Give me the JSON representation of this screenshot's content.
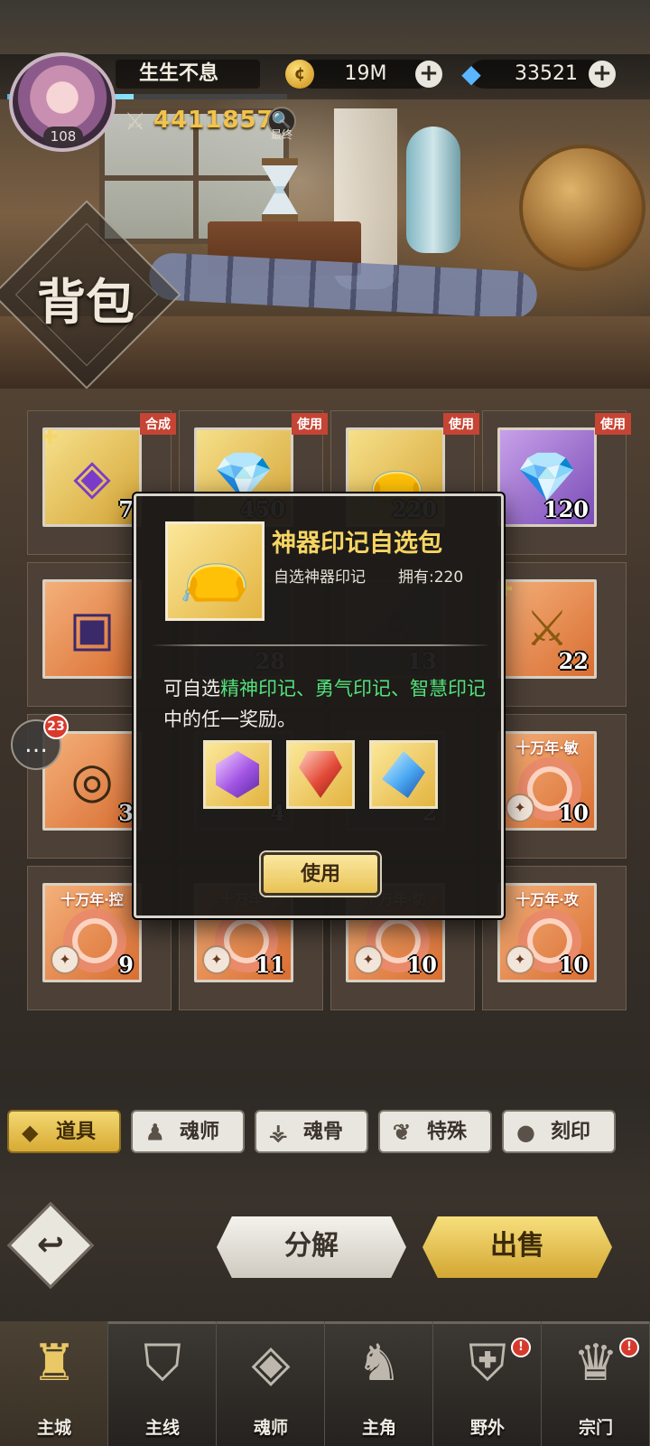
{
  "header": {
    "page_title": "背包",
    "player_name": "生生不息",
    "player_level": "108",
    "xp_progress": 0.45,
    "power": "44118570",
    "rank_label": "最终",
    "gold": "19M",
    "diamonds": "33521"
  },
  "grid": {
    "rows": [
      [
        {
          "tag": "合成",
          "count": "7",
          "color": "gold",
          "icon": "purple-crystal-fragment",
          "puzzle": true
        },
        {
          "tag": "使用",
          "count": "450",
          "color": "gold",
          "icon": "crystal-chest"
        },
        {
          "tag": "使用",
          "count": "220",
          "color": "gold",
          "icon": "gold-pouch"
        },
        {
          "tag": "使用",
          "count": "120",
          "color": "purple",
          "icon": "crystal-chest"
        }
      ],
      [
        {
          "count": "",
          "color": "orange",
          "icon": "dark-chest"
        },
        {
          "count": "28",
          "color": "dim",
          "icon": "figure"
        },
        {
          "count": "13",
          "color": "dim",
          "icon": "figure"
        },
        {
          "count": "22",
          "color": "orange",
          "icon": "golden-sword",
          "puzzle": true
        }
      ],
      [
        {
          "count": "3",
          "color": "orange",
          "icon": "ornate-ring"
        },
        {
          "count": "4",
          "color": "dim",
          "icon": "figure"
        },
        {
          "count": "2",
          "color": "dim",
          "icon": "figure"
        },
        {
          "count": "10",
          "color": "orange",
          "icon": "soul-ring",
          "toptext": "十万年·敏"
        }
      ],
      [
        {
          "count": "9",
          "color": "orange",
          "icon": "soul-ring",
          "toptext": "十万年·控"
        },
        {
          "count": "11",
          "color": "orange",
          "icon": "soul-ring",
          "toptext": "十万年·"
        },
        {
          "count": "10",
          "color": "orange",
          "icon": "soul-ring",
          "toptext": "十万年·防"
        },
        {
          "count": "10",
          "color": "orange",
          "icon": "soul-ring",
          "toptext": "十万年·攻"
        }
      ]
    ]
  },
  "popup": {
    "title": "神器印记自选包",
    "subtitle": "自选神器印记",
    "own_label": "拥有:220",
    "desc_prefix": "可自选",
    "desc_highlight": "精神印记、勇气印记、智慧印记",
    "desc_suffix": "中的任一奖励。",
    "rewards": [
      "purple-seal-gem",
      "red-seal-gem",
      "blue-seal-gem"
    ],
    "use_button": "使用"
  },
  "chat": {
    "badge": "23"
  },
  "categories": [
    {
      "label": "道具",
      "icon": "props-icon",
      "active": true
    },
    {
      "label": "魂师",
      "icon": "soul-master-icon",
      "active": false
    },
    {
      "label": "魂骨",
      "icon": "soul-bone-icon",
      "active": false
    },
    {
      "label": "特殊",
      "icon": "special-icon",
      "active": false
    },
    {
      "label": "刻印",
      "icon": "engrave-icon",
      "active": false
    }
  ],
  "actions": {
    "decompose": "分解",
    "sell": "出售"
  },
  "nav": [
    {
      "label": "主城",
      "icon": "castle-icon",
      "active": true
    },
    {
      "label": "主线",
      "icon": "mainline-icon",
      "active": false
    },
    {
      "label": "魂师",
      "icon": "soul-master-icon",
      "active": false
    },
    {
      "label": "主角",
      "icon": "hero-icon",
      "active": false
    },
    {
      "label": "野外",
      "icon": "field-icon",
      "active": false,
      "alert": "!"
    },
    {
      "label": "宗门",
      "icon": "sect-icon",
      "active": false,
      "alert": "!"
    }
  ]
}
